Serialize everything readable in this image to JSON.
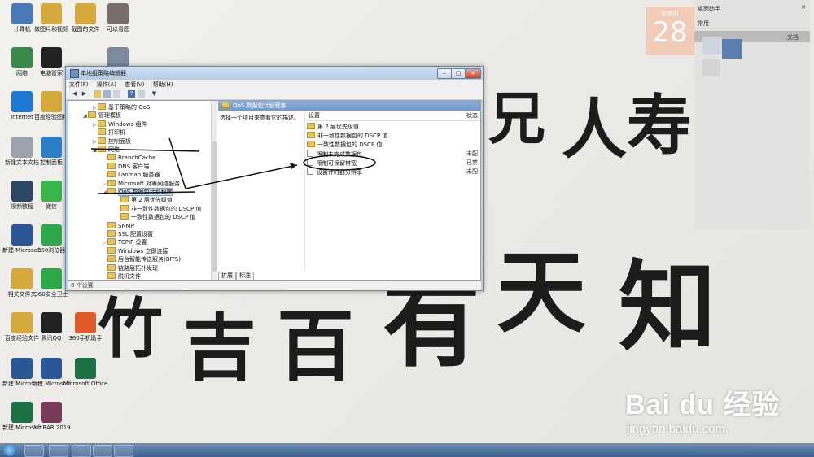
{
  "desktop_icons": [
    {
      "label": "计算机",
      "color": "#4a79b8"
    },
    {
      "label": "做图片和视频",
      "color": "#d6a93c"
    },
    {
      "label": "截图的文件",
      "color": "#d6a93c"
    },
    {
      "label": "可以看图",
      "color": "#7a6e6a"
    },
    {
      "label": "网络",
      "color": "#3b8a4a"
    },
    {
      "label": "电脑管家",
      "color": "#222222"
    },
    {
      "label": "回收站",
      "color": "#7d8aa0"
    },
    {
      "label": "Internet",
      "color": "#1d79d2"
    },
    {
      "label": "百度经验图片",
      "color": "#d6a93c"
    },
    {
      "label": "新建文本文档",
      "color": "#9aa3ad"
    },
    {
      "label": "控制面板",
      "color": "#2f7fc8"
    },
    {
      "label": "视频教程",
      "color": "#2c4766"
    },
    {
      "label": "微信",
      "color": "#39b54a"
    },
    {
      "label": "新建 Microsoft",
      "color": "#2b5797"
    },
    {
      "label": "360浏览器",
      "color": "#2ea84a"
    },
    {
      "label": "相关文件夹",
      "color": "#d6a93c"
    },
    {
      "label": "360安全卫士",
      "color": "#2ea84a"
    },
    {
      "label": "百度经验文件",
      "color": "#d6a93c"
    },
    {
      "label": "腾讯QQ",
      "color": "#222222"
    },
    {
      "label": "360手机助手",
      "color": "#e05a2a"
    },
    {
      "label": "新建 Microsoft",
      "color": "#2b5797"
    },
    {
      "label": "新建 Microsoft",
      "color": "#2b5797"
    },
    {
      "label": "Microsoft Office",
      "color": "#1e7145"
    },
    {
      "label": "新建 Microsoft",
      "color": "#1e7145"
    },
    {
      "label": "WinRAR 2019",
      "color": "#7a3b5a"
    }
  ],
  "calendar": {
    "weekday": "星期四",
    "day": "28"
  },
  "sidepanel": {
    "title": "桌面助手",
    "tab1": "常用",
    "tab2": "文档"
  },
  "window": {
    "title": "本地组策略编辑器",
    "menu": [
      "文件(F)",
      "操作(A)",
      "查看(V)",
      "帮助(H)"
    ],
    "tree": [
      {
        "label": "基于策略的 QoS",
        "level": 2,
        "expander": "▷"
      },
      {
        "label": "管理模板",
        "level": 1,
        "expander": "◢"
      },
      {
        "label": "Windows 组件",
        "level": 2,
        "expander": "▷"
      },
      {
        "label": "打印机",
        "level": 2,
        "expander": ""
      },
      {
        "label": "控制面板",
        "level": 2,
        "expander": "▷"
      },
      {
        "label": "网络",
        "level": 2,
        "expander": "◢"
      },
      {
        "label": "BranchCache",
        "level": 3,
        "expander": ""
      },
      {
        "label": "DNS 客户端",
        "level": 3,
        "expander": ""
      },
      {
        "label": "Lanman 服务器",
        "level": 3,
        "expander": ""
      },
      {
        "label": "Microsoft 对等网络服务",
        "level": 3,
        "expander": "▷"
      },
      {
        "label": "QoS 数据包计划程序",
        "level": 3,
        "expander": "◢",
        "selected": true
      },
      {
        "label": "第 2 层优先级值",
        "level": 4,
        "expander": ""
      },
      {
        "label": "非一致性数据包的 DSCP 值",
        "level": 4,
        "expander": ""
      },
      {
        "label": "一致性数据包的 DSCP 值",
        "level": 4,
        "expander": ""
      },
      {
        "label": "SNMP",
        "level": 3,
        "expander": ""
      },
      {
        "label": "SSL 配置设置",
        "level": 3,
        "expander": ""
      },
      {
        "label": "TCPIP 设置",
        "level": 3,
        "expander": "▷"
      },
      {
        "label": "Windows 立即连接",
        "level": 3,
        "expander": ""
      },
      {
        "label": "后台智能传送服务(BITS)",
        "level": 3,
        "expander": ""
      },
      {
        "label": "链路层拓扑发现",
        "level": 3,
        "expander": ""
      },
      {
        "label": "脱机文件",
        "level": 3,
        "expander": ""
      }
    ],
    "detail_header": "QoS 数据包计划程序",
    "description": "选择一个项目来查看它的描述。",
    "columns": {
      "setting": "设置",
      "state": "状态"
    },
    "list": [
      {
        "label": "第 2 层优先级值",
        "kind": "folder",
        "state": ""
      },
      {
        "label": "非一致性数据包的 DSCP 值",
        "kind": "folder",
        "state": ""
      },
      {
        "label": "一致性数据包的 DSCP 值",
        "kind": "folder",
        "state": ""
      },
      {
        "label": "限制未完成数据包",
        "kind": "policy",
        "state": "未配"
      },
      {
        "label": "限制可保留带宽",
        "kind": "policy",
        "state": "已禁"
      },
      {
        "label": "设置计时器分辨率",
        "kind": "policy",
        "state": "未配"
      }
    ],
    "tabs": [
      "扩展",
      "标准"
    ],
    "status": "8 个设置"
  },
  "watermark": {
    "brand": "Bai du 经验",
    "url": "jingyan.baidu.com"
  }
}
